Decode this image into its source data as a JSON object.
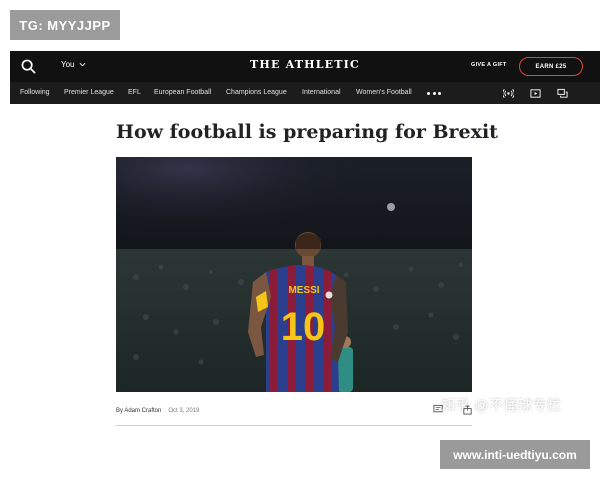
{
  "overlay": {
    "tg_badge": "TG: MYYJJPP",
    "watermark": "知乎 @不懂球专栏",
    "site_badge": "www.inti-uedtiyu.com"
  },
  "header": {
    "you_label": "You",
    "brand": "THE ATHLETIC",
    "gift_label": "GIVE A GIFT",
    "earn_label": "EARN £25"
  },
  "nav": {
    "items": [
      "Following",
      "Premier League",
      "EFL",
      "European Football",
      "Champions League",
      "International",
      "Women's Football"
    ]
  },
  "article": {
    "title": "How football is preparing for Brexit",
    "author": "By Adam Crafton",
    "date": "Oct 3, 2019",
    "jersey_name": "MESSI",
    "jersey_number": "10"
  },
  "colors": {
    "topbar": "#111111",
    "navbar": "#1c1c1c",
    "accent": "#d8463c",
    "jersey_blue": "#2c3f8f",
    "jersey_red": "#8b1d3b",
    "jersey_yellow": "#f5c518"
  },
  "icons": {
    "search": "search-icon",
    "podcast": "podcast-icon",
    "video": "video-icon",
    "comments": "comments-icon"
  }
}
